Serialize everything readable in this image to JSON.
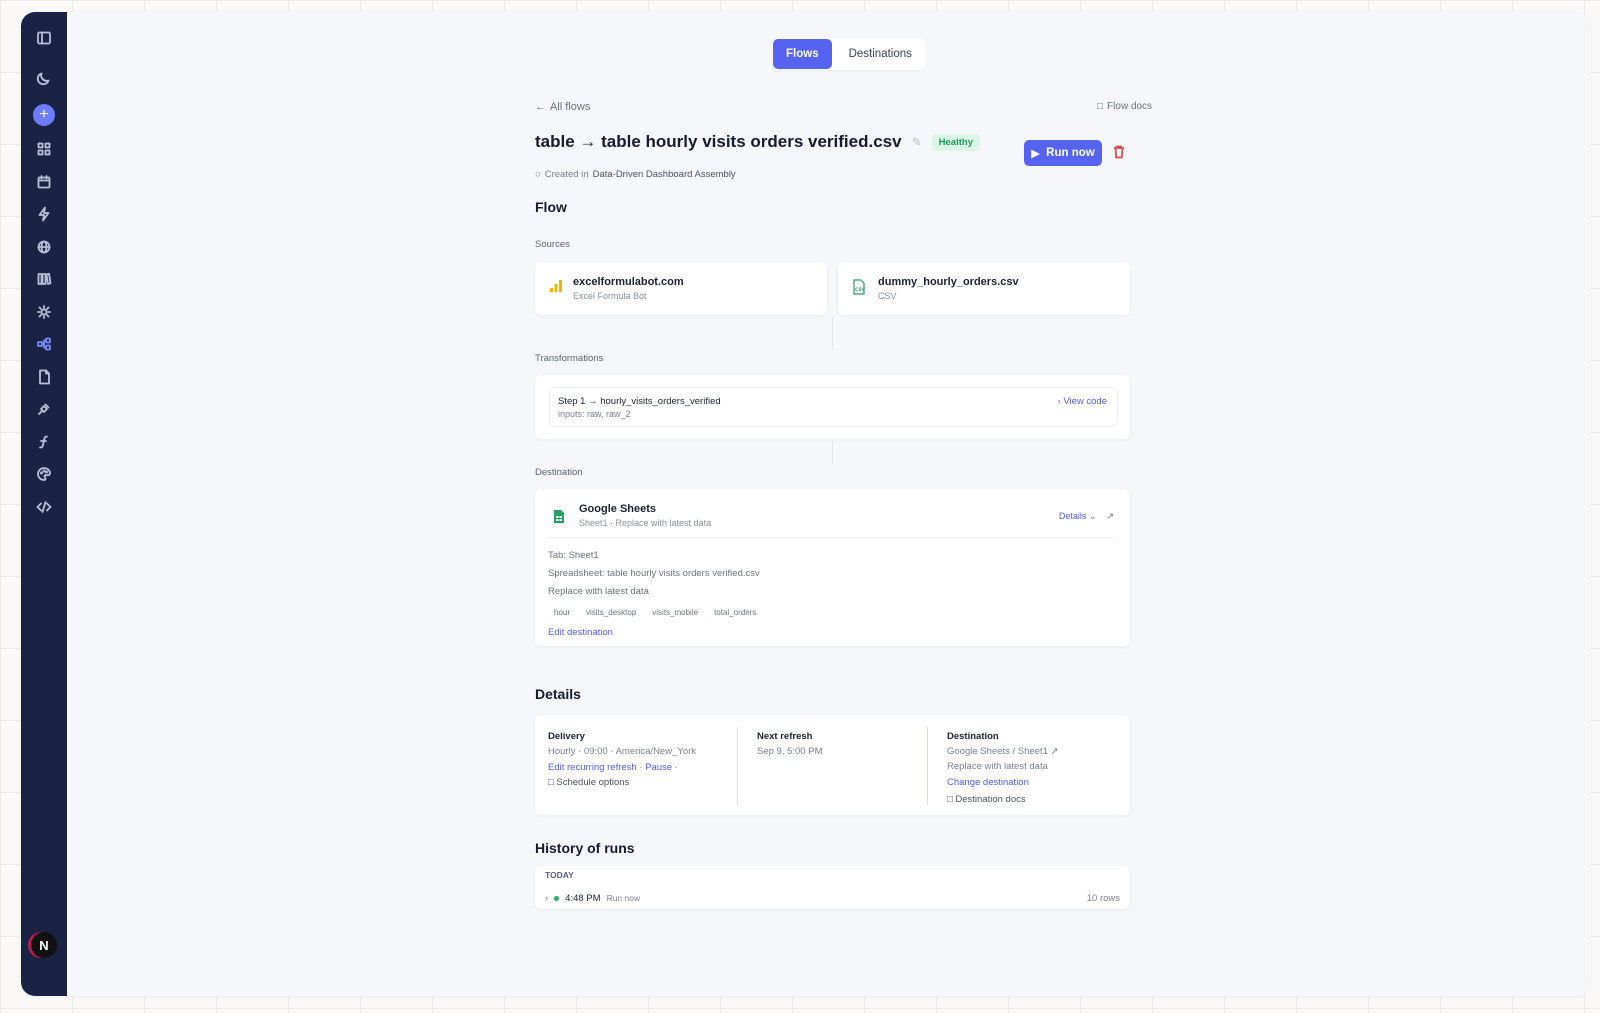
{
  "tabs": {
    "flows": "Flows",
    "destinations": "Destinations"
  },
  "nav": {
    "back": "All flows",
    "flow_docs": "Flow docs"
  },
  "flow": {
    "title": "table → table hourly visits orders verified.csv",
    "status": "Healthy",
    "run_label": "Run now",
    "created_prefix": "Created in",
    "created_in": "Data-Driven Dashboard Assembly"
  },
  "flow_section": {
    "heading": "Flow",
    "sources_label": "Sources",
    "sources": [
      {
        "name": "excelformulabot.com",
        "type": "Excel Formula Bot"
      },
      {
        "name": "dummy_hourly_orders.csv",
        "type": "CSV"
      }
    ],
    "transformations_label": "Transformations",
    "step": {
      "title": "Step 1 → hourly_visits_orders_verified",
      "inputs": "inputs: raw, raw_2",
      "view_code": "View code"
    },
    "destination_label": "Destination",
    "destination": {
      "name": "Google Sheets",
      "sub": "Sheet1 · Replace with latest data",
      "details_label": "Details",
      "tab": "Tab: Sheet1",
      "spreadsheet": "Spreadsheet: table hourly visits orders verified.csv",
      "mode": "Replace with latest data",
      "columns": [
        "hour",
        "visits_desktop",
        "visits_mobile",
        "total_orders"
      ],
      "edit_label": "Edit destination"
    }
  },
  "details": {
    "heading": "Details",
    "delivery": {
      "head": "Delivery",
      "schedule": "Hourly · 09:00 · America/New_York",
      "edit_label": "Edit recurring refresh",
      "pause_label": "Pause",
      "options_label": "Schedule options"
    },
    "next_refresh": {
      "head": "Next refresh",
      "value": "Sep 9, 5:00 PM"
    },
    "destination": {
      "head": "Destination",
      "value": "Google Sheets / Sheet1",
      "mode": "Replace with latest data",
      "change_label": "Change destination",
      "docs_label": "Destination docs"
    }
  },
  "history": {
    "heading": "History of runs",
    "group": "TODAY",
    "runs": [
      {
        "time": "4:48 PM",
        "trigger": "Run now",
        "rows": "10 rows"
      }
    ]
  },
  "user": {
    "initial": "N"
  },
  "colors": {
    "accent": "#5563f0",
    "sidebar": "#1a2344",
    "healthy": "#1e9a59",
    "danger": "#e24b4b"
  }
}
